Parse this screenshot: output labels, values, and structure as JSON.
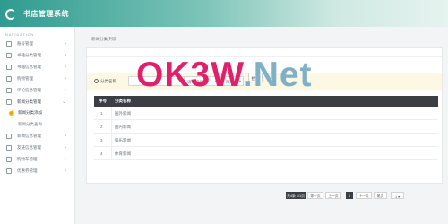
{
  "app": {
    "title": "书店管理系统"
  },
  "sidebar": {
    "heading": "NAVIGATION",
    "items": [
      {
        "label": "账号管理",
        "expanded": false
      },
      {
        "label": "书籍分类管理",
        "expanded": false
      },
      {
        "label": "书籍信息管理",
        "expanded": false
      },
      {
        "label": "购物管理",
        "expanded": false
      },
      {
        "label": "评论信息管理",
        "expanded": false
      },
      {
        "label": "新闻分类管理",
        "expanded": true,
        "children": [
          "新闻分类添加",
          "新闻分类查询"
        ]
      },
      {
        "label": "新闻信息管理",
        "expanded": false
      },
      {
        "label": "友链信息管理",
        "expanded": false
      },
      {
        "label": "购物车管理",
        "expanded": false
      },
      {
        "label": "优惠券管理",
        "expanded": false
      }
    ]
  },
  "main": {
    "breadcrumb": "新闻分类 列表",
    "filter": {
      "search_label": "分类名称",
      "search_value": "",
      "select1": "请选择时间",
      "select2": "降序",
      "search_button": "搜索"
    },
    "table": {
      "headers": [
        "序号",
        "分类名称"
      ],
      "rows": [
        [
          "1",
          "国外新闻"
        ],
        [
          "2",
          "国内新闻"
        ],
        [
          "3",
          "娱乐新闻"
        ],
        [
          "4",
          "体育新闻"
        ]
      ]
    },
    "pagination": {
      "summary": "共4条 1/1页",
      "first": "第一页",
      "prev": "上一页",
      "current": "1",
      "next": "下一页",
      "last": "尾页",
      "page_select": "1"
    }
  },
  "watermark": {
    "part1": "OK3W",
    "part2": ".Net"
  },
  "colors": {
    "topbar": "#2f9b8f",
    "table_header": "#3b3f44",
    "filter_bg": "#fdf8e4",
    "watermark_pink": "#e0206a",
    "watermark_blue": "#7fb0c6"
  }
}
